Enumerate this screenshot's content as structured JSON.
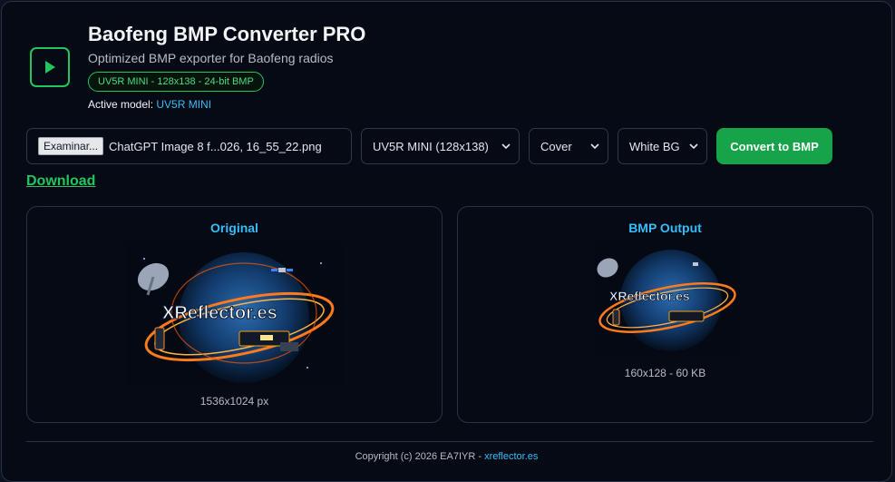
{
  "header": {
    "title": "Baofeng BMP Converter PRO",
    "subtitle": "Optimized BMP exporter for Baofeng radios",
    "badge": "UV5R MINI - 128x138 - 24-bit BMP",
    "active_model_label": "Active model:",
    "active_model_value": "UV5R MINI",
    "logo_icon": "play-icon"
  },
  "controls": {
    "file_button": "Examinar...",
    "file_name": "ChatGPT Image 8 f...026, 16_55_22.png",
    "model_select": "UV5R MINI (128x138)",
    "fit_select": "Cover",
    "bg_select": "White BG",
    "convert_button": "Convert to BMP",
    "download_link": "Download"
  },
  "original": {
    "title": "Original",
    "caption": "1536x1024 px",
    "image_text": "XReflector.es"
  },
  "output": {
    "title": "BMP Output",
    "caption": "160x128 - 60 KB",
    "image_text": "XReflector.es"
  },
  "footer": {
    "copyright": "Copyright (c) 2026 EA7IYR - ",
    "link": "xreflector.es"
  },
  "colors": {
    "accent_green": "#22c55e",
    "accent_blue": "#38bdf8",
    "background": "#050a14"
  }
}
